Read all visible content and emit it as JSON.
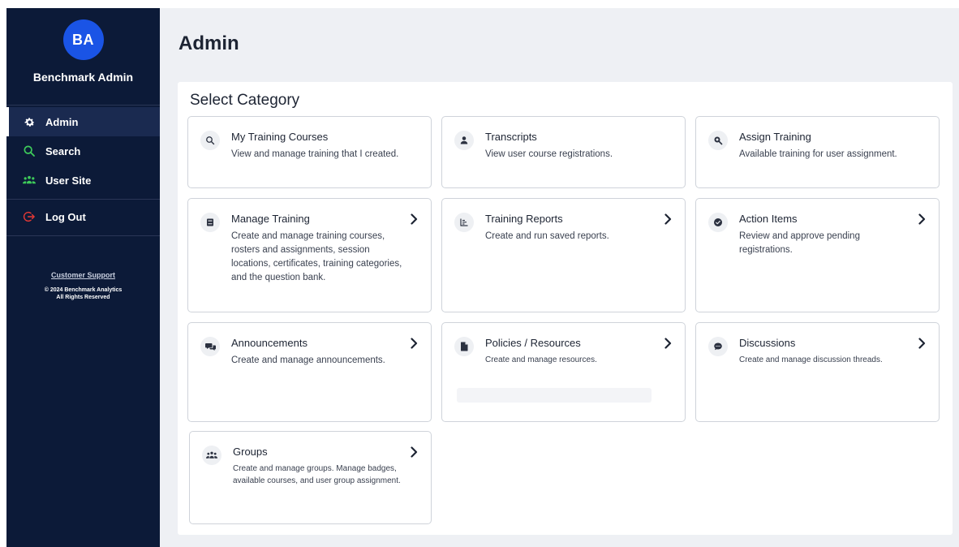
{
  "sidebar": {
    "avatar_initials": "BA",
    "user_name": "Benchmark Admin",
    "nav": [
      {
        "label": "Admin",
        "icon": "gear-icon",
        "active": true
      },
      {
        "label": "Search",
        "icon": "search-icon"
      },
      {
        "label": "User Site",
        "icon": "users-icon"
      }
    ],
    "logout_label": "Log Out",
    "support_label": "Customer Support",
    "copyright_line1": "© 2024 Benchmark Analytics",
    "copyright_line2": "All Rights Reserved"
  },
  "main": {
    "page_title": "Admin",
    "section_title": "Select Category",
    "cards": [
      {
        "title": "My Training Courses",
        "desc": "View and manage training that I created.",
        "icon": "search-icon",
        "chevron": false
      },
      {
        "title": "Transcripts",
        "desc": "View user course registrations.",
        "icon": "user-icon",
        "chevron": false
      },
      {
        "title": "Assign Training",
        "desc": "Available training for user assignment.",
        "icon": "magnify-icon",
        "chevron": false
      },
      {
        "title": "Manage Training",
        "desc": "Create and manage training courses, rosters and assignments, session locations, certificates, training categories, and the question bank.",
        "icon": "book-icon",
        "chevron": true
      },
      {
        "title": "Training Reports",
        "desc": "Create and run saved reports.",
        "icon": "report-icon",
        "chevron": true
      },
      {
        "title": "Action Items",
        "desc": "Review and approve pending registrations.",
        "icon": "check-circle-icon",
        "chevron": true
      },
      {
        "title": "Announcements",
        "desc": "Create and manage announcements.",
        "icon": "chat-icon",
        "chevron": true
      },
      {
        "title": "Policies / Resources",
        "desc": "Create and manage resources.",
        "icon": "file-icon",
        "chevron": true
      },
      {
        "title": "Discussions",
        "desc": "Create and manage discussion threads.",
        "icon": "comment-icon",
        "chevron": true
      },
      {
        "title": "Groups",
        "desc": "Create and manage groups. Manage badges, available courses, and user group assignment.",
        "icon": "group-icon",
        "chevron": true
      }
    ]
  },
  "colors": {
    "sidebar_bg": "#0c1a38",
    "avatar_bg": "#1a54e6",
    "accent_green": "#3ecb5a",
    "logout_red": "#e53935"
  }
}
